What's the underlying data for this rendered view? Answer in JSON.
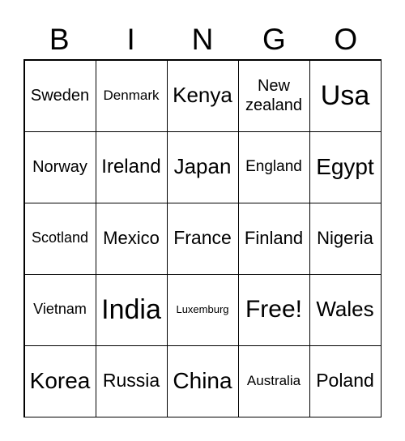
{
  "header": [
    "B",
    "I",
    "N",
    "G",
    "O"
  ],
  "cells": [
    "Sweden",
    "Denmark",
    "Kenya",
    "New zealand",
    "Usa",
    "Norway",
    "Ireland",
    "Japan",
    "England",
    "Egypt",
    "Scotland",
    "Mexico",
    "France",
    "Finland",
    "Nigeria",
    "Vietnam",
    "India",
    "Luxemburg",
    "Free!",
    "Wales",
    "Korea",
    "Russia",
    "China",
    "Australia",
    "Poland"
  ]
}
